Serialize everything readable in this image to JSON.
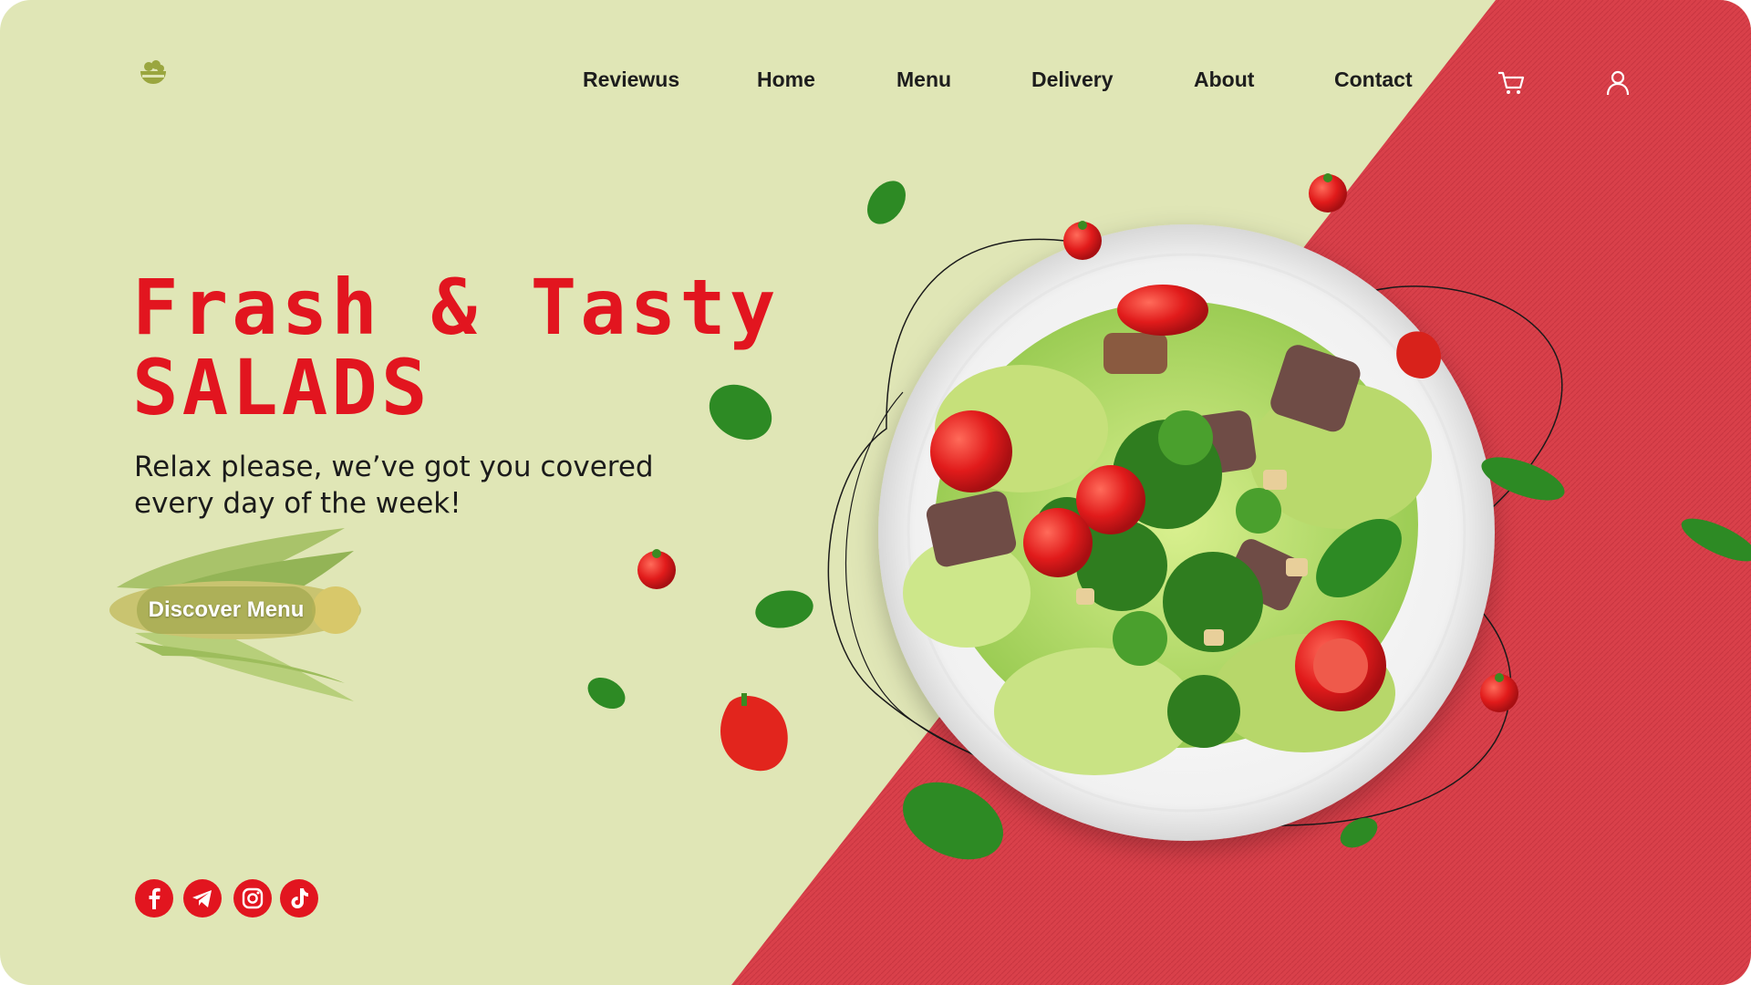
{
  "colors": {
    "background": "#e0e6b6",
    "accent_red": "#e2151f",
    "panel_red": "#d9404a",
    "text_dark": "#1d1d1d"
  },
  "header": {
    "logo_icon": "salad-bowl-icon",
    "nav": [
      {
        "label": "Reviewus"
      },
      {
        "label": "Home"
      },
      {
        "label": "Menu"
      },
      {
        "label": "Delivery"
      },
      {
        "label": "About"
      },
      {
        "label": "Contact"
      }
    ],
    "cart_icon": "shopping-cart-icon",
    "user_icon": "user-icon"
  },
  "hero": {
    "headline_line1": "Frash & Tasty",
    "headline_line2": "SALADS",
    "subtitle": "Relax please, we’ve got you covered every day of the week!",
    "cta_label": "Discover Menu"
  },
  "social": [
    {
      "icon": "facebook-icon"
    },
    {
      "icon": "telegram-icon"
    },
    {
      "icon": "instagram-icon"
    },
    {
      "icon": "tiktok-icon"
    }
  ]
}
